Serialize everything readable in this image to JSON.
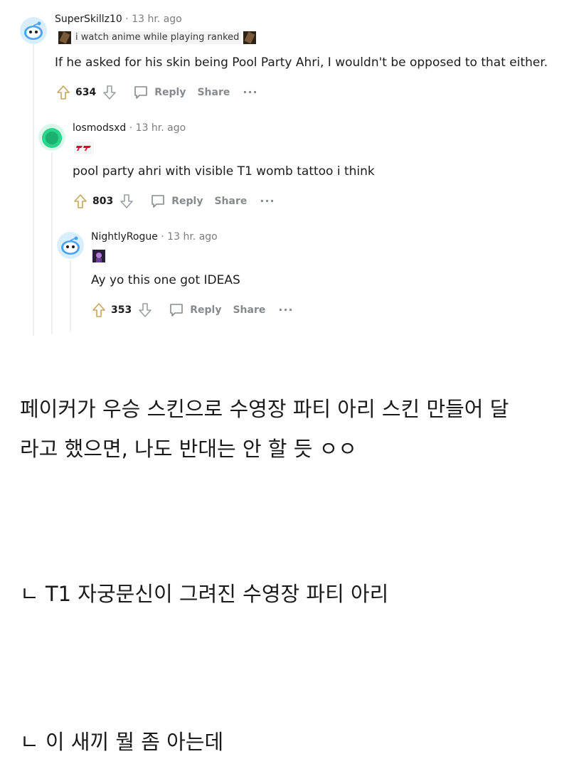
{
  "comments": [
    {
      "username": "SuperSkillz10",
      "time": "· 13 hr. ago",
      "flair": "i watch anime while playing ranked",
      "body": "If he asked for his skin being Pool Party Ahri, I wouldn't be opposed to that either.",
      "score": "634",
      "reply_label": "Reply",
      "share_label": "Share",
      "more_label": "···",
      "avatar_color": "#4aa4f2"
    },
    {
      "username": "losmodsxd",
      "time": "· 13 hr. ago",
      "flair": "T1",
      "body": "pool party ahri with visible T1 womb tattoo i think",
      "score": "803",
      "reply_label": "Reply",
      "share_label": "Share",
      "more_label": "···",
      "avatar_color": "#2ad48a"
    },
    {
      "username": "NightlyRogue",
      "time": "· 13 hr. ago",
      "flair": "",
      "body": "Ay yo this one got IDEAS",
      "score": "353",
      "reply_label": "Reply",
      "share_label": "Share",
      "more_label": "···",
      "avatar_color": "#4aa4f2"
    }
  ],
  "translations": {
    "line1": "페이커가 우승 스킨으로 수영장 파티 아리 스킨 만들어 달",
    "line2": "라고 했으면, 나도 반대는 안 할 듯 ㅇㅇ",
    "line3": "ㄴ T1 자궁문신이 그려진 수영장 파티 아리",
    "line4": "ㄴ 이 새끼 뭘 좀 아는데"
  },
  "colors": {
    "text": "#1c1c1c",
    "muted": "#878a8c",
    "thread_line": "#edeff1",
    "t1_red": "#e2012d"
  }
}
